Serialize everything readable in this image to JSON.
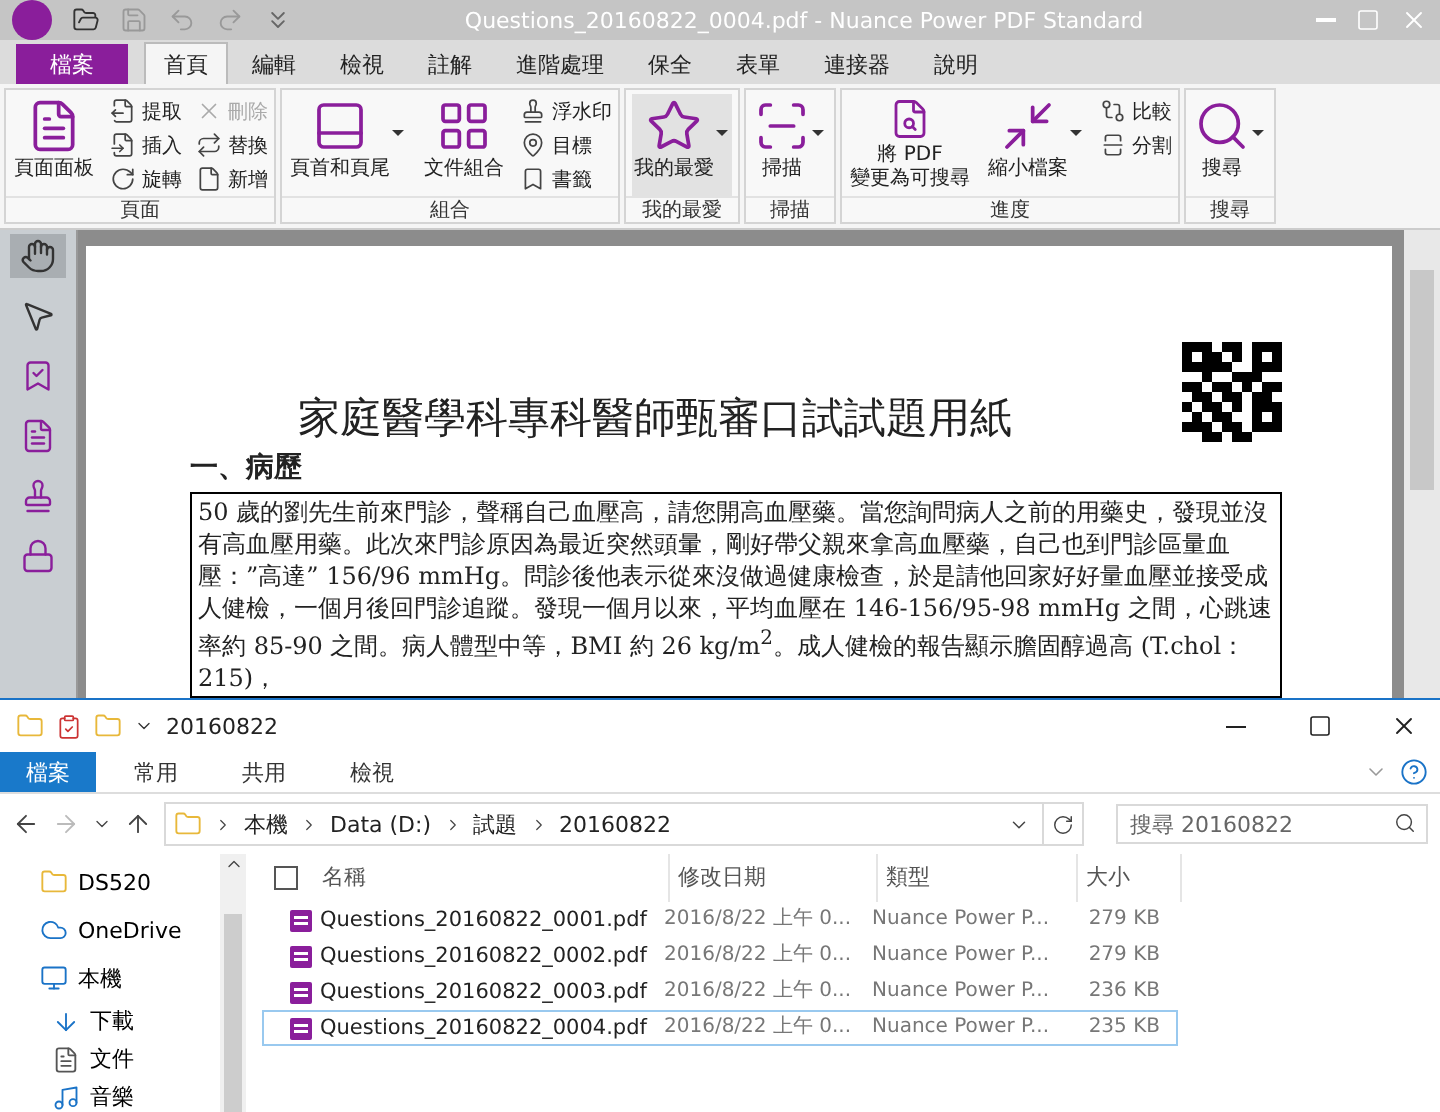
{
  "pdf_app": {
    "title": "Questions_20160822_0004.pdf - Nuance Power PDF Standard",
    "file_button": "檔案",
    "tabs": [
      {
        "label": "首頁",
        "selected": true
      },
      {
        "label": "編輯",
        "selected": false
      },
      {
        "label": "檢視",
        "selected": false
      },
      {
        "label": "註解",
        "selected": false
      },
      {
        "label": "進階處理",
        "selected": false
      },
      {
        "label": "保全",
        "selected": false
      },
      {
        "label": "表單",
        "selected": false
      },
      {
        "label": "連接器",
        "selected": false
      },
      {
        "label": "說明",
        "selected": false
      }
    ],
    "ribbon_groups": [
      {
        "label": "頁面",
        "items": [
          {
            "kind": "large",
            "label": "頁面面板",
            "dropdown": false,
            "highlighted": false
          },
          {
            "kind": "small",
            "label": "提取",
            "disabled": false
          },
          {
            "kind": "small",
            "label": "插入",
            "disabled": false
          },
          {
            "kind": "small",
            "label": "旋轉",
            "disabled": false
          },
          {
            "kind": "small",
            "label": "刪除",
            "disabled": true
          },
          {
            "kind": "small",
            "label": "替換",
            "disabled": false
          },
          {
            "kind": "small",
            "label": "新增",
            "disabled": false
          }
        ]
      },
      {
        "label": "組合",
        "items": [
          {
            "kind": "large",
            "label": "頁首和頁尾",
            "dropdown": true,
            "highlighted": false
          },
          {
            "kind": "large",
            "label": "文件組合",
            "dropdown": false,
            "highlighted": false
          },
          {
            "kind": "small",
            "label": "浮水印",
            "disabled": false
          },
          {
            "kind": "small",
            "label": "目標",
            "disabled": false
          },
          {
            "kind": "small",
            "label": "書籤",
            "disabled": false
          }
        ]
      },
      {
        "label": "我的最愛",
        "items": [
          {
            "kind": "large",
            "label": "我的最愛",
            "dropdown": true,
            "highlighted": true
          }
        ]
      },
      {
        "label": "掃描",
        "items": [
          {
            "kind": "large",
            "label": "掃描",
            "dropdown": true,
            "highlighted": false
          }
        ]
      },
      {
        "label": "進度",
        "items": [
          {
            "kind": "large",
            "label": "將 PDF\n變更為可搜尋",
            "dropdown": false,
            "highlighted": false
          },
          {
            "kind": "large",
            "label": "縮小檔案",
            "dropdown": true,
            "highlighted": false
          },
          {
            "kind": "small",
            "label": "比較",
            "disabled": false
          },
          {
            "kind": "small",
            "label": "分割",
            "disabled": false
          }
        ]
      },
      {
        "label": "搜尋",
        "items": [
          {
            "kind": "large",
            "label": "搜尋",
            "dropdown": true,
            "highlighted": false
          }
        ]
      }
    ],
    "tools": [
      {
        "selected": true
      },
      {
        "selected": false
      },
      {
        "selected": false
      },
      {
        "selected": false
      },
      {
        "selected": false
      },
      {
        "selected": false
      }
    ],
    "document": {
      "heading": "家庭醫學科專科醫師甄審口試試題用紙",
      "section": "一、病歷",
      "paragraph": "50 歲的劉先生前來門診，聲稱自己血壓高，請您開高血壓藥。當您詢問病人之前的用藥史，發現並沒有高血壓用藥。此次來門診原因為最近突然頭暈，剛好帶父親來拿高血壓藥，自己也到門診區量血壓：”高達” 156/96 mmHg。問診後他表示從來沒做過健康檢查，於是請他回家好好量血壓並接受成人健檢，一個月後回門診追蹤。發現一個月以來，平均血壓在 146-156/95-98 mmHg 之間，心跳速率約 85-90 之間。病人體型中等，BMI 約 26 kg/m$^{2}$。成人健檢的報告顯示膽固醇過高 (T.chol：215)，"
    }
  },
  "explorer": {
    "title": "20160822",
    "tabs": [
      {
        "label": "檔案",
        "selected": true
      },
      {
        "label": "常用",
        "selected": false
      },
      {
        "label": "共用",
        "selected": false
      },
      {
        "label": "檢視",
        "selected": false
      }
    ],
    "breadcrumbs": [
      "本機",
      "Data (D:)",
      "試題",
      "20160822"
    ],
    "search": {
      "placeholder": "搜尋 20160822"
    },
    "nav": [
      {
        "label": "DS520"
      },
      {
        "label": "OneDrive"
      },
      {
        "label": "本機",
        "children": [
          {
            "label": "下載"
          },
          {
            "label": "文件"
          },
          {
            "label": "音樂"
          }
        ]
      }
    ],
    "select_all_checked": false,
    "columns": [
      "名稱",
      "修改日期",
      "類型",
      "大小"
    ],
    "rows": [
      {
        "name": "Questions_20160822_0001.pdf",
        "modified": "2016/8/22 上午 0...",
        "type": "Nuance Power P...",
        "size": "279 KB",
        "selected": false
      },
      {
        "name": "Questions_20160822_0002.pdf",
        "modified": "2016/8/22 上午 0...",
        "type": "Nuance Power P...",
        "size": "279 KB",
        "selected": false
      },
      {
        "name": "Questions_20160822_0003.pdf",
        "modified": "2016/8/22 上午 0...",
        "type": "Nuance Power P...",
        "size": "236 KB",
        "selected": false
      },
      {
        "name": "Questions_20160822_0004.pdf",
        "modified": "2016/8/22 上午 0...",
        "type": "Nuance Power P...",
        "size": "235 KB",
        "selected": true
      }
    ]
  }
}
